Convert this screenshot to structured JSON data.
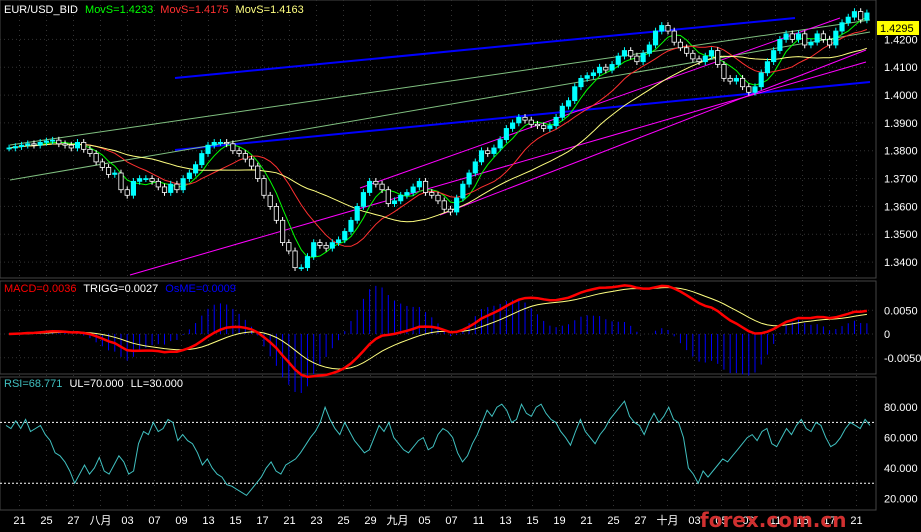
{
  "colors": {
    "up": "#00ffff",
    "down": "#ffffff",
    "movs1": "#00ff00",
    "movs2": "#ff3030",
    "movs3": "#ffff80",
    "channel": "#0000ff",
    "magenta": "#ff00ff",
    "greenline": "#80c080",
    "macd": "#ff0000",
    "trigg": "#ffff80",
    "osc": "#0000ff",
    "rsi": "#40c0c0",
    "grid": "#333333",
    "last": "#ffff00"
  },
  "chart_data": [
    {
      "type": "candlestick",
      "symbol": "EUR/USD_BID",
      "indicators": [
        {
          "label": "MovS=1.4233",
          "color": "#00ff00"
        },
        {
          "label": "MovS=1.4175",
          "color": "#ff3030"
        },
        {
          "label": "MovS=1.4163",
          "color": "#ffff80"
        }
      ],
      "ylim": [
        1.335,
        1.432
      ],
      "yticks": [
        "1.4200",
        "1.4100",
        "1.4000",
        "1.3900",
        "1.3800",
        "1.3700",
        "1.3600",
        "1.3500",
        "1.3400"
      ],
      "last_price": "1.4295",
      "close": [
        1.381,
        1.3815,
        1.382,
        1.3825,
        1.382,
        1.383,
        1.3835,
        1.3838,
        1.3825,
        1.382,
        1.381,
        1.383,
        1.3805,
        1.379,
        1.376,
        1.374,
        1.3715,
        1.372,
        1.366,
        1.364,
        1.369,
        1.37,
        1.37,
        1.369,
        1.367,
        1.365,
        1.368,
        1.366,
        1.37,
        1.372,
        1.375,
        1.379,
        1.382,
        1.383,
        1.383,
        1.3825,
        1.38,
        1.379,
        1.377,
        1.3745,
        1.37,
        1.364,
        1.36,
        1.355,
        1.347,
        1.344,
        1.338,
        1.338,
        1.342,
        1.347,
        1.346,
        1.345,
        1.347,
        1.348,
        1.351,
        1.355,
        1.36,
        1.365,
        1.369,
        1.368,
        1.366,
        1.361,
        1.362,
        1.364,
        1.365,
        1.367,
        1.369,
        1.365,
        1.364,
        1.362,
        1.359,
        1.358,
        1.363,
        1.368,
        1.372,
        1.376,
        1.38,
        1.379,
        1.381,
        1.384,
        1.388,
        1.39,
        1.392,
        1.391,
        1.3895,
        1.389,
        1.388,
        1.389,
        1.392,
        1.396,
        1.398,
        1.403,
        1.406,
        1.407,
        1.408,
        1.41,
        1.409,
        1.411,
        1.414,
        1.416,
        1.414,
        1.412,
        1.415,
        1.418,
        1.423,
        1.425,
        1.423,
        1.419,
        1.417,
        1.415,
        1.413,
        1.412,
        1.414,
        1.416,
        1.411,
        1.406,
        1.405,
        1.406,
        1.403,
        1.401,
        1.403,
        1.408,
        1.412,
        1.416,
        1.42,
        1.422,
        1.42,
        1.422,
        1.418,
        1.419,
        1.422,
        1.42,
        1.418,
        1.423,
        1.426,
        1.428,
        1.43,
        1.427,
        1.4295
      ]
    },
    {
      "type": "line",
      "name": "MACD",
      "labels": [
        {
          "label": "MACD=0.0036",
          "color": "#ff0000"
        },
        {
          "label": "TRIGG=0.0027",
          "color": "#ffffff"
        },
        {
          "label": "OsME=0.0009",
          "color": "#0000ff"
        }
      ],
      "ylim": [
        -0.008,
        0.008
      ],
      "yticks": [
        "0.0050",
        "0",
        "-0.0050"
      ]
    },
    {
      "type": "line",
      "name": "RSI",
      "labels": [
        {
          "label": "RSI=68.771",
          "color": "#40c0c0"
        },
        {
          "label": "UL=70.000",
          "color": "#ffffff"
        },
        {
          "label": "LL=30.000",
          "color": "#ffffff"
        }
      ],
      "ylim": [
        15,
        90
      ],
      "yticks": [
        "80.000",
        "60.000",
        "40.000",
        "20.000"
      ],
      "values": [
        68,
        66,
        71,
        66,
        72,
        64,
        66,
        68,
        62,
        58,
        50,
        48,
        44,
        38,
        30,
        36,
        42,
        36,
        40,
        47,
        38,
        36,
        42,
        48,
        44,
        36,
        38,
        56,
        64,
        62,
        70,
        64,
        66,
        72,
        70,
        58,
        62,
        58,
        56,
        50,
        42,
        46,
        40,
        36,
        34,
        29,
        28,
        26,
        24,
        22,
        26,
        30,
        34,
        40,
        44,
        38,
        36,
        42,
        44,
        46,
        50,
        55,
        60,
        64,
        70,
        80,
        72,
        66,
        62,
        70,
        64,
        58,
        54,
        50,
        52,
        60,
        68,
        64,
        70,
        60,
        56,
        52,
        50,
        54,
        58,
        60,
        52,
        54,
        62,
        66,
        64,
        60,
        50,
        44,
        48,
        56,
        62,
        70,
        78,
        74,
        80,
        82,
        78,
        70,
        72,
        82,
        76,
        74,
        80,
        82,
        76,
        72,
        70,
        64,
        60,
        55,
        64,
        72,
        64,
        60,
        56,
        62,
        66,
        72,
        76,
        80,
        84,
        74,
        70,
        68,
        62,
        70,
        76,
        70,
        74,
        80,
        72,
        70,
        60,
        40,
        36,
        30,
        38,
        34,
        38,
        42,
        46,
        44,
        48,
        52,
        56,
        60,
        62,
        58,
        64,
        66,
        56,
        54,
        60,
        66,
        62,
        68,
        72,
        66,
        64,
        70,
        68,
        60,
        54,
        56,
        60,
        66,
        70,
        68,
        66,
        72,
        68
      ]
    },
    {
      "type": "axis",
      "name": "time",
      "xticks": [
        "21",
        "25",
        "27",
        "八月",
        "03",
        "07",
        "09",
        "13",
        "15",
        "17",
        "21",
        "23",
        "25",
        "29",
        "九月",
        "05",
        "07",
        "11",
        "13",
        "15",
        "19",
        "21",
        "25",
        "27",
        "十月",
        "03",
        "05",
        "09",
        "11",
        "15",
        "17",
        "21"
      ]
    }
  ],
  "watermark": "forex.com.cn"
}
